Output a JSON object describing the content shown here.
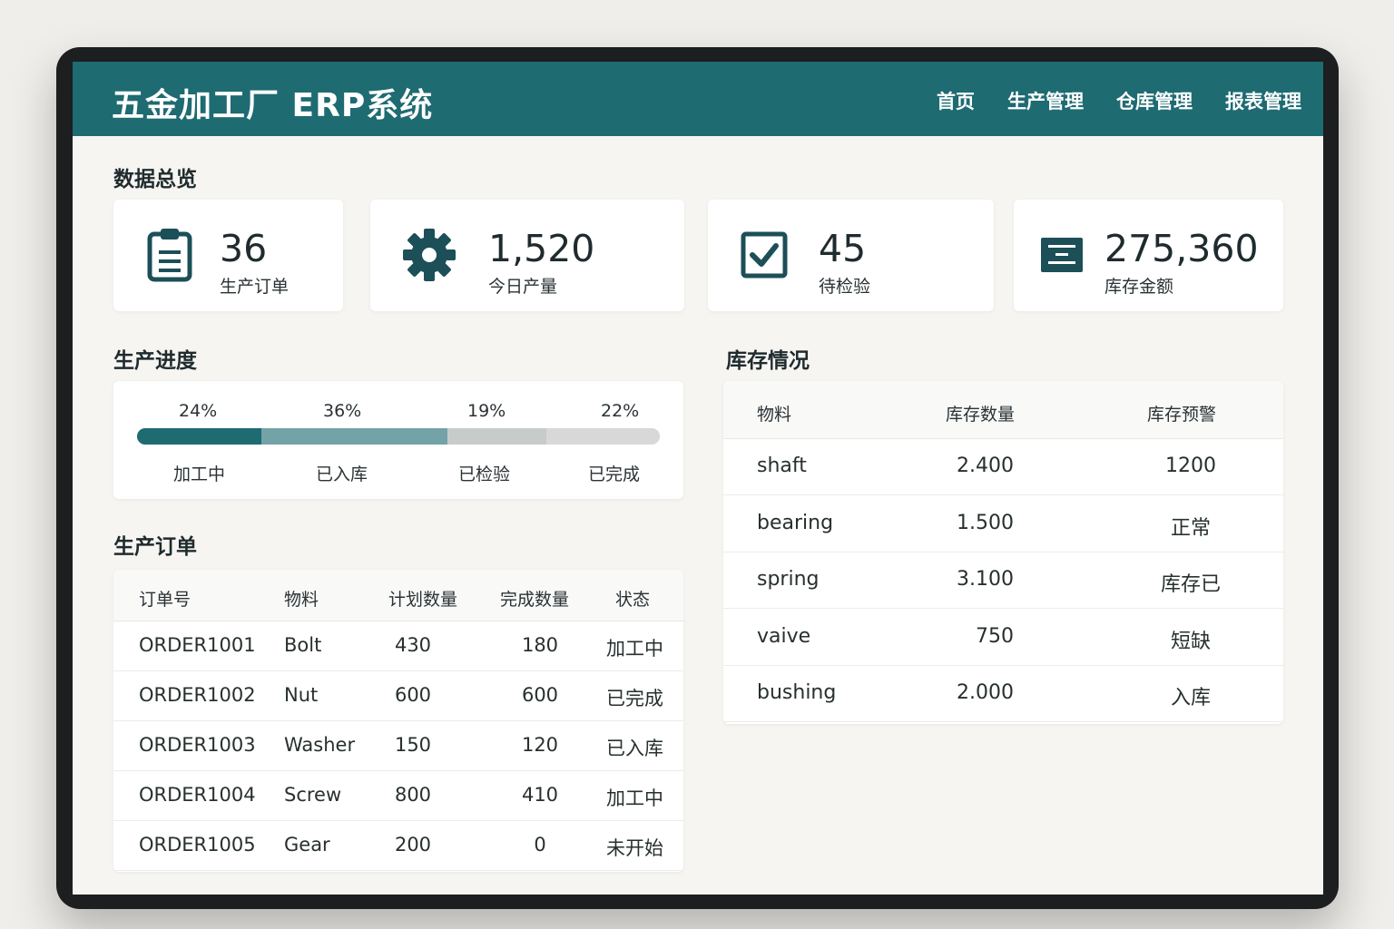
{
  "header": {
    "title": "五金加工厂 ERP系统",
    "nav": [
      "首页",
      "生产管理",
      "仓库管理",
      "报表管理"
    ]
  },
  "overview": {
    "title": "数据总览",
    "kpis": [
      {
        "value": "36",
        "label": "生产订单",
        "icon": "clipboard-icon"
      },
      {
        "value": "1,520",
        "label": "今日产量",
        "icon": "gear-icon"
      },
      {
        "value": "45",
        "label": "待检验",
        "icon": "checkbox-icon"
      },
      {
        "value": "275,360",
        "label": "库存金额",
        "icon": "warehouse-icon"
      }
    ]
  },
  "progress": {
    "title": "生产进度",
    "stages": [
      {
        "pct": "24%",
        "label": "加工中",
        "value": 24,
        "color": "#1e6b72"
      },
      {
        "pct": "36%",
        "label": "已入库",
        "value": 36,
        "color": "#73a3a6"
      },
      {
        "pct": "19%",
        "label": "已检验",
        "value": 19,
        "color": "#c7cccb"
      },
      {
        "pct": "22%",
        "label": "已完成",
        "value": 22,
        "color": "#d7d8d7"
      }
    ]
  },
  "orders": {
    "title": "生产订单",
    "columns": [
      "订单号",
      "物料",
      "计划数量",
      "完成数量",
      "状态"
    ],
    "rows": [
      [
        "ORDER1001",
        "Bolt",
        "430",
        "180",
        "加工中"
      ],
      [
        "ORDER1002",
        "Nut",
        "600",
        "600",
        "已完成"
      ],
      [
        "ORDER1003",
        "Washer",
        "150",
        "120",
        "已入库"
      ],
      [
        "ORDER1004",
        "Screw",
        "800",
        "410",
        "加工中"
      ],
      [
        "ORDER1005",
        "Gear",
        "200",
        "0",
        "未开始"
      ]
    ]
  },
  "inventory": {
    "title": "库存情况",
    "columns": [
      "物料",
      "库存数量",
      "库存预警"
    ],
    "rows": [
      [
        "shaft",
        "2.400",
        "1200"
      ],
      [
        "bearing",
        "1.500",
        "正常"
      ],
      [
        "spring",
        "3.100",
        "库存已"
      ],
      [
        "vaive",
        "750",
        "短缺"
      ],
      [
        "bushing",
        "2.000",
        "入库"
      ]
    ]
  },
  "colors": {
    "primary": "#1e6b72",
    "icon": "#1c4f58"
  }
}
